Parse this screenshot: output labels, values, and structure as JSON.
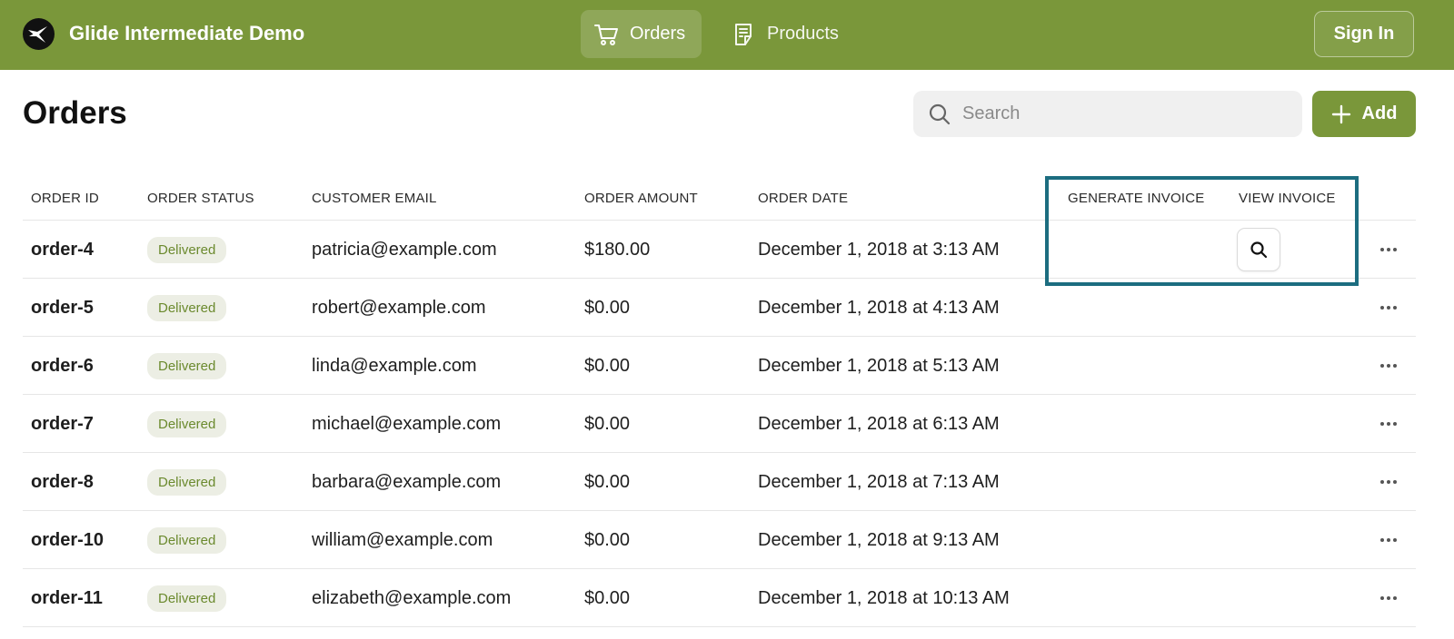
{
  "app": {
    "title": "Glide Intermediate Demo",
    "brand_color": "#7a973a",
    "logo_icon": "glide-logo-icon"
  },
  "nav": {
    "tabs": [
      {
        "label": "Orders",
        "icon": "cart-icon",
        "active": true
      },
      {
        "label": "Products",
        "icon": "notepad-icon",
        "active": false
      }
    ],
    "sign_in_label": "Sign In"
  },
  "page": {
    "title": "Orders",
    "search": {
      "placeholder": "Search",
      "value": ""
    },
    "add_label": "Add"
  },
  "table": {
    "columns": [
      "ORDER ID",
      "ORDER STATUS",
      "CUSTOMER EMAIL",
      "ORDER AMOUNT",
      "ORDER DATE",
      "GENERATE INVOICE",
      "VIEW INVOICE"
    ],
    "rows": [
      {
        "id": "order-4",
        "status": "Delivered",
        "email": "patricia@example.com",
        "amount": "$180.00",
        "date": "December 1, 2018 at 3:13 AM",
        "has_view_invoice": true
      },
      {
        "id": "order-5",
        "status": "Delivered",
        "email": "robert@example.com",
        "amount": "$0.00",
        "date": "December 1, 2018 at 4:13 AM",
        "has_view_invoice": false
      },
      {
        "id": "order-6",
        "status": "Delivered",
        "email": "linda@example.com",
        "amount": "$0.00",
        "date": "December 1, 2018 at 5:13 AM",
        "has_view_invoice": false
      },
      {
        "id": "order-7",
        "status": "Delivered",
        "email": "michael@example.com",
        "amount": "$0.00",
        "date": "December 1, 2018 at 6:13 AM",
        "has_view_invoice": false
      },
      {
        "id": "order-8",
        "status": "Delivered",
        "email": "barbara@example.com",
        "amount": "$0.00",
        "date": "December 1, 2018 at 7:13 AM",
        "has_view_invoice": false
      },
      {
        "id": "order-10",
        "status": "Delivered",
        "email": "william@example.com",
        "amount": "$0.00",
        "date": "December 1, 2018 at 9:13 AM",
        "has_view_invoice": false
      },
      {
        "id": "order-11",
        "status": "Delivered",
        "email": "elizabeth@example.com",
        "amount": "$0.00",
        "date": "December 1, 2018 at 10:13 AM",
        "has_view_invoice": false
      }
    ],
    "highlight_color": "#1c6d80"
  }
}
